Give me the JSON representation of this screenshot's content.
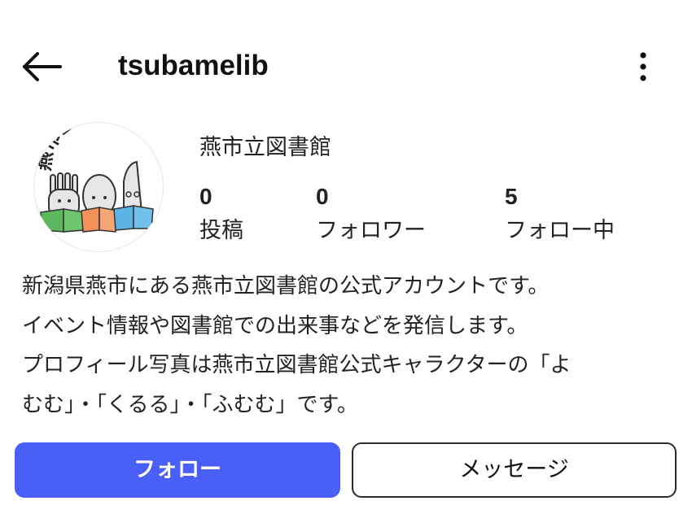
{
  "header": {
    "back_icon": "arrow-left-icon",
    "username": "tsubamelib",
    "more_icon": "more-vertical-icon"
  },
  "profile": {
    "display_name": "燕市立図書館",
    "avatar_text": "燕市立図書館",
    "stats": {
      "posts": {
        "count": "0",
        "label": "投稿"
      },
      "followers": {
        "count": "0",
        "label": "フォロワー"
      },
      "following": {
        "count": "5",
        "label": "フォロー中"
      }
    },
    "bio_lines": [
      "新潟県燕市にある燕市立図書館の公式アカウントです。",
      "イベント情報や図書館での出来事などを発信します。",
      "プロフィール写真は燕市立図書館公式キャラクターの「よ",
      "むむ」・「くるる」・「ふむむ」です。"
    ]
  },
  "actions": {
    "follow_label": "フォロー",
    "message_label": "メッセージ"
  },
  "colors": {
    "follow_button": "#4a5ff7",
    "book_green": "#5cb85c",
    "book_orange": "#f2915a",
    "book_blue": "#5bb3e6"
  }
}
